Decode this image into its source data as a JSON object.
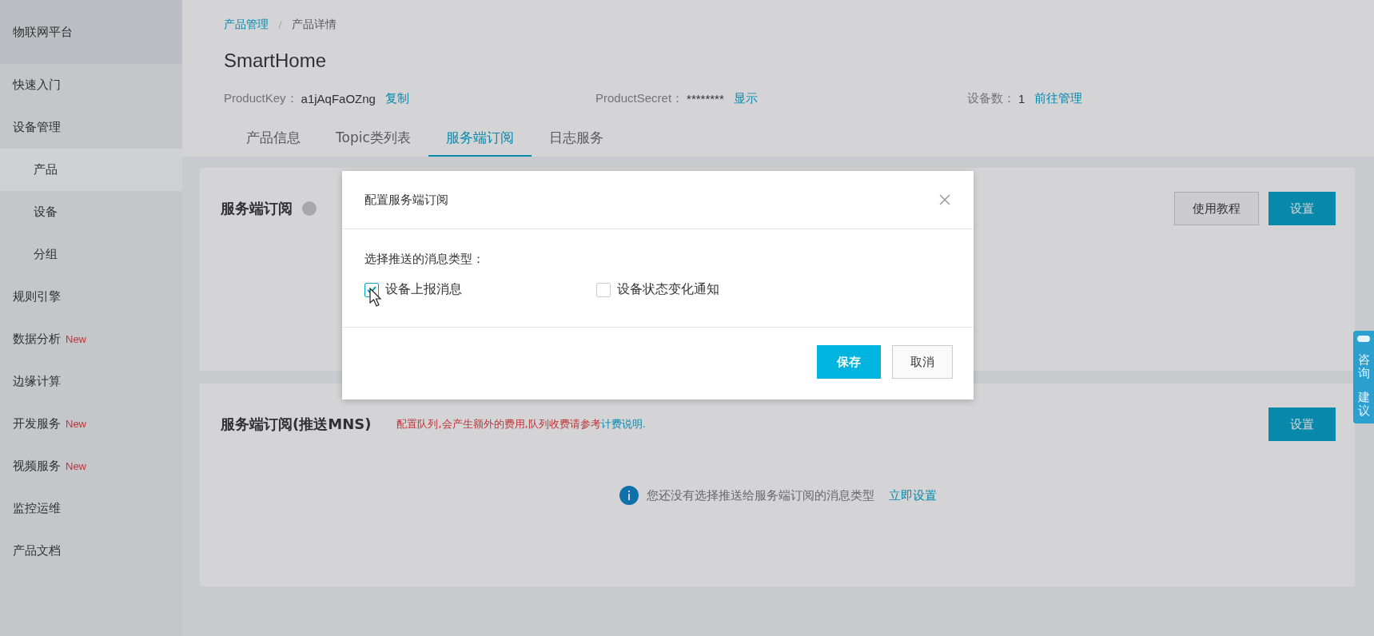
{
  "sidebar": {
    "title": "物联网平台",
    "items": [
      {
        "label": "快速入门",
        "selected": false
      },
      {
        "label": "设备管理",
        "selected": false,
        "children": [
          {
            "label": "产品",
            "selected": true
          },
          {
            "label": "设备",
            "selected": false
          },
          {
            "label": "分组",
            "selected": false
          }
        ]
      },
      {
        "label": "规则引擎",
        "selected": false
      },
      {
        "label": "数据分析",
        "badge": "New",
        "selected": false
      },
      {
        "label": "边缘计算",
        "selected": false
      },
      {
        "label": "开发服务",
        "badge": "New",
        "selected": false
      },
      {
        "label": "视频服务",
        "badge": "New",
        "selected": false
      },
      {
        "label": "监控运维",
        "selected": false
      },
      {
        "label": "产品文档",
        "selected": false
      }
    ]
  },
  "breadcrumb": [
    {
      "label": "产品管理",
      "kind": "link"
    },
    {
      "label": "产品详情",
      "kind": "current"
    }
  ],
  "product": {
    "name": "SmartHome",
    "fields": [
      {
        "label": "ProductKey：",
        "value": "a1jAqFaOZng",
        "action": "复制"
      },
      {
        "label": "ProductSecret：",
        "value": "********",
        "action": "显示"
      },
      {
        "label": "设备数：",
        "value": "1",
        "action": "前往管理"
      }
    ]
  },
  "tabs": [
    {
      "label": "产品信息",
      "selected": false
    },
    {
      "label": "Topic类列表",
      "selected": false
    },
    {
      "label": "服务端订阅",
      "selected": true
    },
    {
      "label": "日志服务",
      "selected": false
    }
  ],
  "sections": [
    {
      "title": "服务端订阅",
      "help": true,
      "buttons": [
        {
          "label": "使用教程",
          "kind": "default"
        },
        {
          "label": "设置",
          "kind": "primary"
        }
      ]
    },
    {
      "title": "服务端订阅(推送MNS)",
      "help": false,
      "notice": "配置队列,会产生额外的费用,队列收费请参考",
      "notice_link": "计费说明.",
      "empty_message": "您还没有选择推送给服务端订阅的消息类型",
      "empty_action": "立即设置",
      "buttons": [
        {
          "label": "设置",
          "kind": "primary"
        }
      ]
    }
  ],
  "dialog": {
    "title": "配置服务端订阅",
    "prompt": "选择推送的消息类型：",
    "options": [
      {
        "label": "设备上报消息",
        "checked": true
      },
      {
        "label": "设备状态变化通知",
        "checked": false
      }
    ],
    "buttons": [
      {
        "label": "保存",
        "kind": "primary"
      },
      {
        "label": "取消",
        "kind": "default"
      }
    ]
  },
  "feedback": {
    "labels": [
      "咨询",
      "建议"
    ]
  }
}
